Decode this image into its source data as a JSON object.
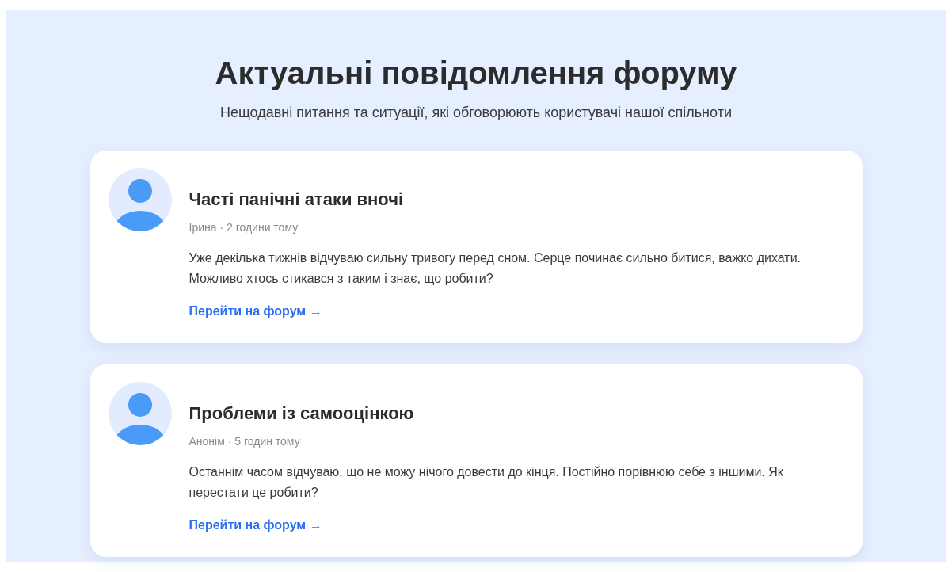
{
  "header": {
    "title": "Актуальні повідомлення форуму",
    "subtitle": "Нещодавні питання та ситуації, які обговорюють користувачі нашої спільноти"
  },
  "posts": [
    {
      "title": "Часті панічні атаки вночі",
      "meta": "Ірина · 2 години тому",
      "text": "Уже декілька тижнів відчуваю сильну тривогу перед сном. Серце починає сильно битися, важко дихати. Можливо хтось стикався з таким і знає, що робити?",
      "link": "Перейти на форум →"
    },
    {
      "title": "Проблеми із самооцінкою",
      "meta": "Анонім · 5 годин тому",
      "text": "Останнім часом відчуваю, що не можу нічого довести до кінця. Постійно порівнюю себе з іншими. Як перестати це робити?",
      "link": "Перейти на форум →"
    }
  ]
}
